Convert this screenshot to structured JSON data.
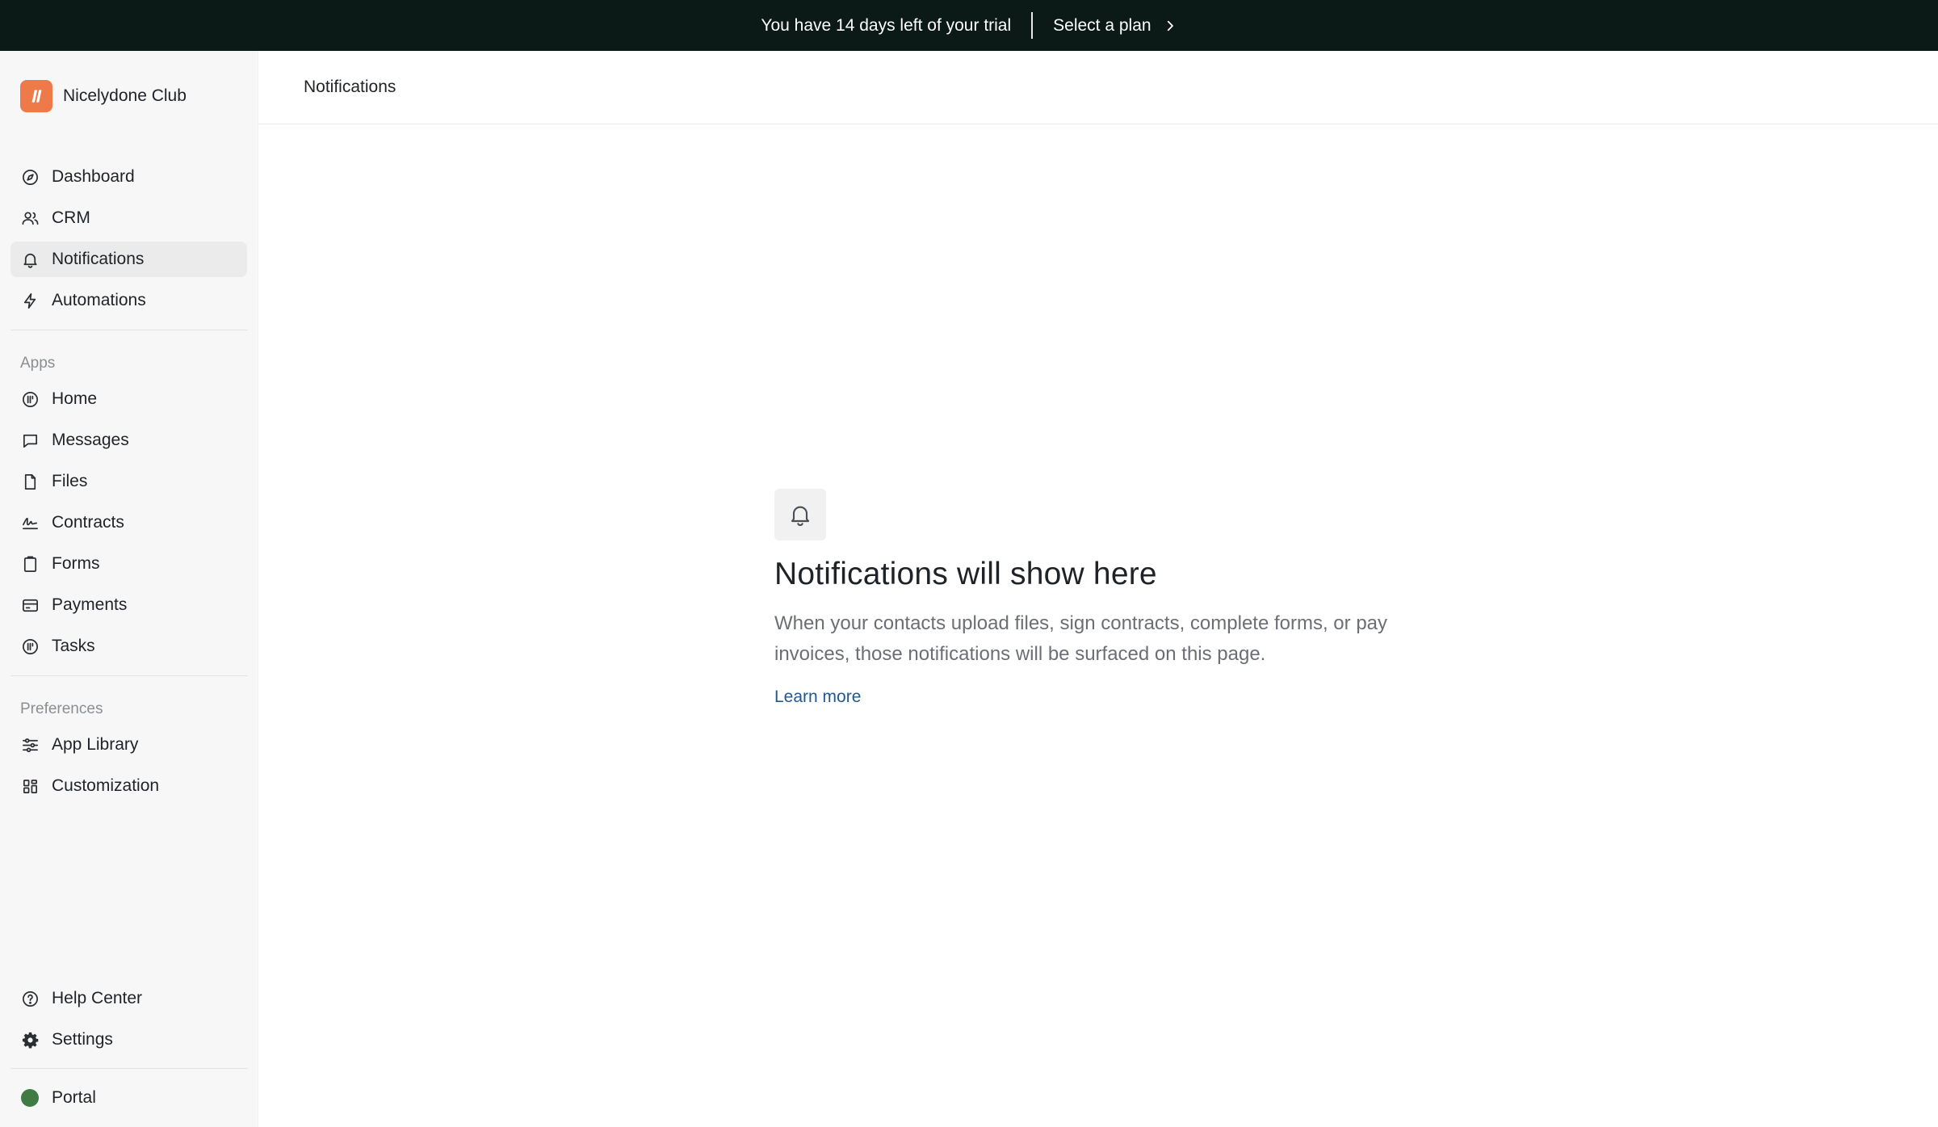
{
  "banner": {
    "message": "You have 14 days left of your trial",
    "cta": "Select a plan"
  },
  "workspace": {
    "name": "Nicelydone Club",
    "logo_color": "#ee7a4a"
  },
  "sidebar": {
    "main_items": [
      {
        "label": "Dashboard",
        "icon": "compass-icon",
        "active": false
      },
      {
        "label": "CRM",
        "icon": "users-icon",
        "active": false
      },
      {
        "label": "Notifications",
        "icon": "bell-icon",
        "active": true
      },
      {
        "label": "Automations",
        "icon": "lightning-icon",
        "active": false
      }
    ],
    "apps_label": "Apps",
    "apps_items": [
      {
        "label": "Home",
        "icon": "home-app-icon"
      },
      {
        "label": "Messages",
        "icon": "message-icon"
      },
      {
        "label": "Files",
        "icon": "file-icon"
      },
      {
        "label": "Contracts",
        "icon": "signature-icon"
      },
      {
        "label": "Forms",
        "icon": "clipboard-icon"
      },
      {
        "label": "Payments",
        "icon": "credit-card-icon"
      },
      {
        "label": "Tasks",
        "icon": "tasks-icon"
      }
    ],
    "preferences_label": "Preferences",
    "preferences_items": [
      {
        "label": "App Library",
        "icon": "sliders-icon"
      },
      {
        "label": "Customization",
        "icon": "grid-icon"
      }
    ],
    "footer_items": [
      {
        "label": "Help Center",
        "icon": "help-icon"
      },
      {
        "label": "Settings",
        "icon": "gear-icon"
      }
    ],
    "portal_label": "Portal",
    "portal_color": "#3f7b43"
  },
  "header": {
    "title": "Notifications"
  },
  "empty_state": {
    "title": "Notifications will show here",
    "description": "When your contacts upload files, sign contracts, complete forms, or pay invoices, those notifications will be surfaced on this page.",
    "link": "Learn more"
  },
  "colors": {
    "banner_bg": "#0b1a16",
    "link": "#1f5a8f",
    "sidebar_bg": "#f7f7f7"
  }
}
